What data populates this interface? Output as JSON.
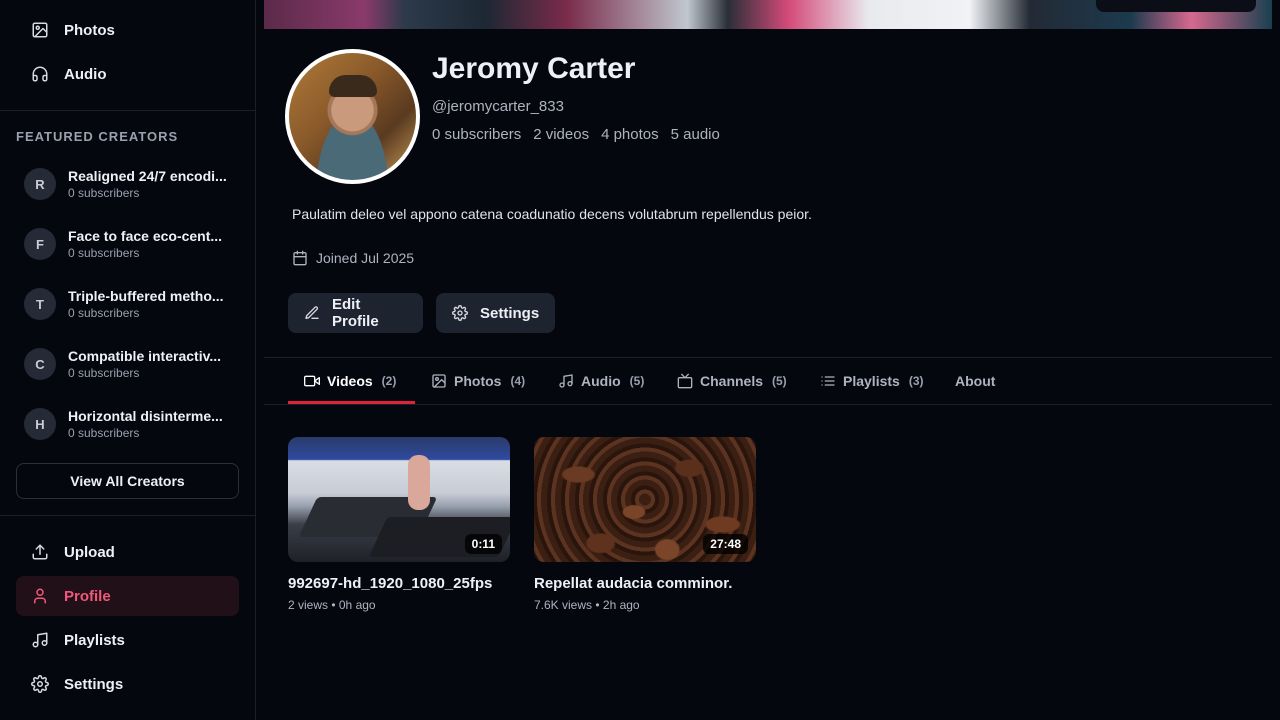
{
  "sidebar": {
    "top_items": [
      {
        "label": "Photos",
        "icon": "image-icon"
      },
      {
        "label": "Audio",
        "icon": "headphones-icon"
      }
    ],
    "featured_title": "FEATURED CREATORS",
    "creators": [
      {
        "initial": "R",
        "name": "Realigned 24/7 encodi...",
        "subs": "0 subscribers"
      },
      {
        "initial": "F",
        "name": "Face to face eco-cent...",
        "subs": "0 subscribers"
      },
      {
        "initial": "T",
        "name": "Triple-buffered metho...",
        "subs": "0 subscribers"
      },
      {
        "initial": "C",
        "name": "Compatible interactiv...",
        "subs": "0 subscribers"
      },
      {
        "initial": "H",
        "name": "Horizontal disinterme...",
        "subs": "0 subscribers"
      }
    ],
    "view_all": "View All Creators",
    "bottom_items": [
      {
        "label": "Upload",
        "icon": "upload-icon"
      },
      {
        "label": "Profile",
        "icon": "user-icon",
        "active": true
      },
      {
        "label": "Playlists",
        "icon": "music-note-icon"
      },
      {
        "label": "Settings",
        "icon": "gear-icon"
      }
    ]
  },
  "profile": {
    "name": "Jeromy Carter",
    "handle": "@jeromycarter_833",
    "stats": [
      "0 subscribers",
      "2 videos",
      "4 photos",
      "5 audio"
    ],
    "bio": "Paulatim deleo vel appono catena coadunatio decens volutabrum repellendus peior.",
    "joined": "Joined Jul 2025",
    "edit_label": "Edit Profile",
    "settings_label": "Settings"
  },
  "tabs": [
    {
      "label": "Videos",
      "count": "(2)",
      "icon": "video-icon",
      "active": true
    },
    {
      "label": "Photos",
      "count": "(4)",
      "icon": "image-icon"
    },
    {
      "label": "Audio",
      "count": "(5)",
      "icon": "music-note-icon"
    },
    {
      "label": "Channels",
      "count": "(5)",
      "icon": "tv-icon"
    },
    {
      "label": "Playlists",
      "count": "(3)",
      "icon": "list-icon"
    },
    {
      "label": "About",
      "count": "",
      "icon": ""
    }
  ],
  "videos": [
    {
      "title": "992697-hd_1920_1080_25fps",
      "duration": "0:11",
      "meta": "2 views • 0h ago"
    },
    {
      "title": "Repellat audacia comminor.",
      "duration": "27:48",
      "meta": "7.6K views • 2h ago"
    }
  ],
  "colors": {
    "accent": "#f0587a",
    "tab_underline": "#e0203c",
    "background": "#05070f"
  }
}
